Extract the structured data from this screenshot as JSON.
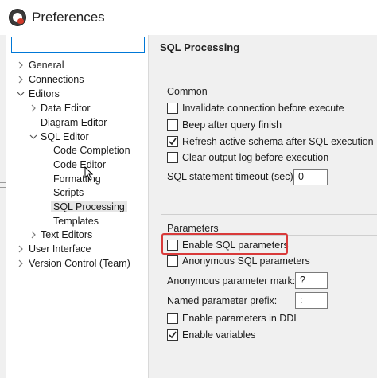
{
  "window": {
    "title": "Preferences"
  },
  "filter": {
    "value": ""
  },
  "tree": {
    "general": "General",
    "connections": "Connections",
    "editors": "Editors",
    "data_editor": "Data Editor",
    "diagram_editor": "Diagram Editor",
    "sql_editor": "SQL Editor",
    "code_completion": "Code Completion",
    "code_editor": "Code Editor",
    "formatting": "Formatting",
    "scripts": "Scripts",
    "sql_processing": "SQL Processing",
    "templates": "Templates",
    "text_editors": "Text Editors",
    "user_interface": "User Interface",
    "version_control": "Version Control (Team)"
  },
  "page": {
    "title": "SQL Processing"
  },
  "common": {
    "label": "Common",
    "invalidate": {
      "label": "Invalidate connection before execute",
      "checked": false
    },
    "beep": {
      "label": "Beep after query finish",
      "checked": false
    },
    "refresh_schema": {
      "label": "Refresh active schema after SQL execution",
      "checked": true
    },
    "clear_log": {
      "label": "Clear output log before execution",
      "checked": false
    },
    "timeout_label": "SQL statement timeout (sec):",
    "timeout_value": "0"
  },
  "parameters": {
    "label": "Parameters",
    "enable_sql_params": {
      "label": "Enable SQL parameters",
      "checked": false
    },
    "anonymous_params": {
      "label": "Anonymous SQL parameters",
      "checked": false
    },
    "anon_mark_label": "Anonymous parameter mark:",
    "anon_mark_value": "?",
    "named_prefix_label": "Named parameter prefix:",
    "named_prefix_value": ":",
    "params_in_ddl": {
      "label": "Enable parameters in DDL",
      "checked": false
    },
    "enable_variables": {
      "label": "Enable variables",
      "checked": true
    }
  },
  "colors": {
    "highlight": "#d93a3a",
    "focus": "#0078d7",
    "selection": "#e6e6e6"
  }
}
